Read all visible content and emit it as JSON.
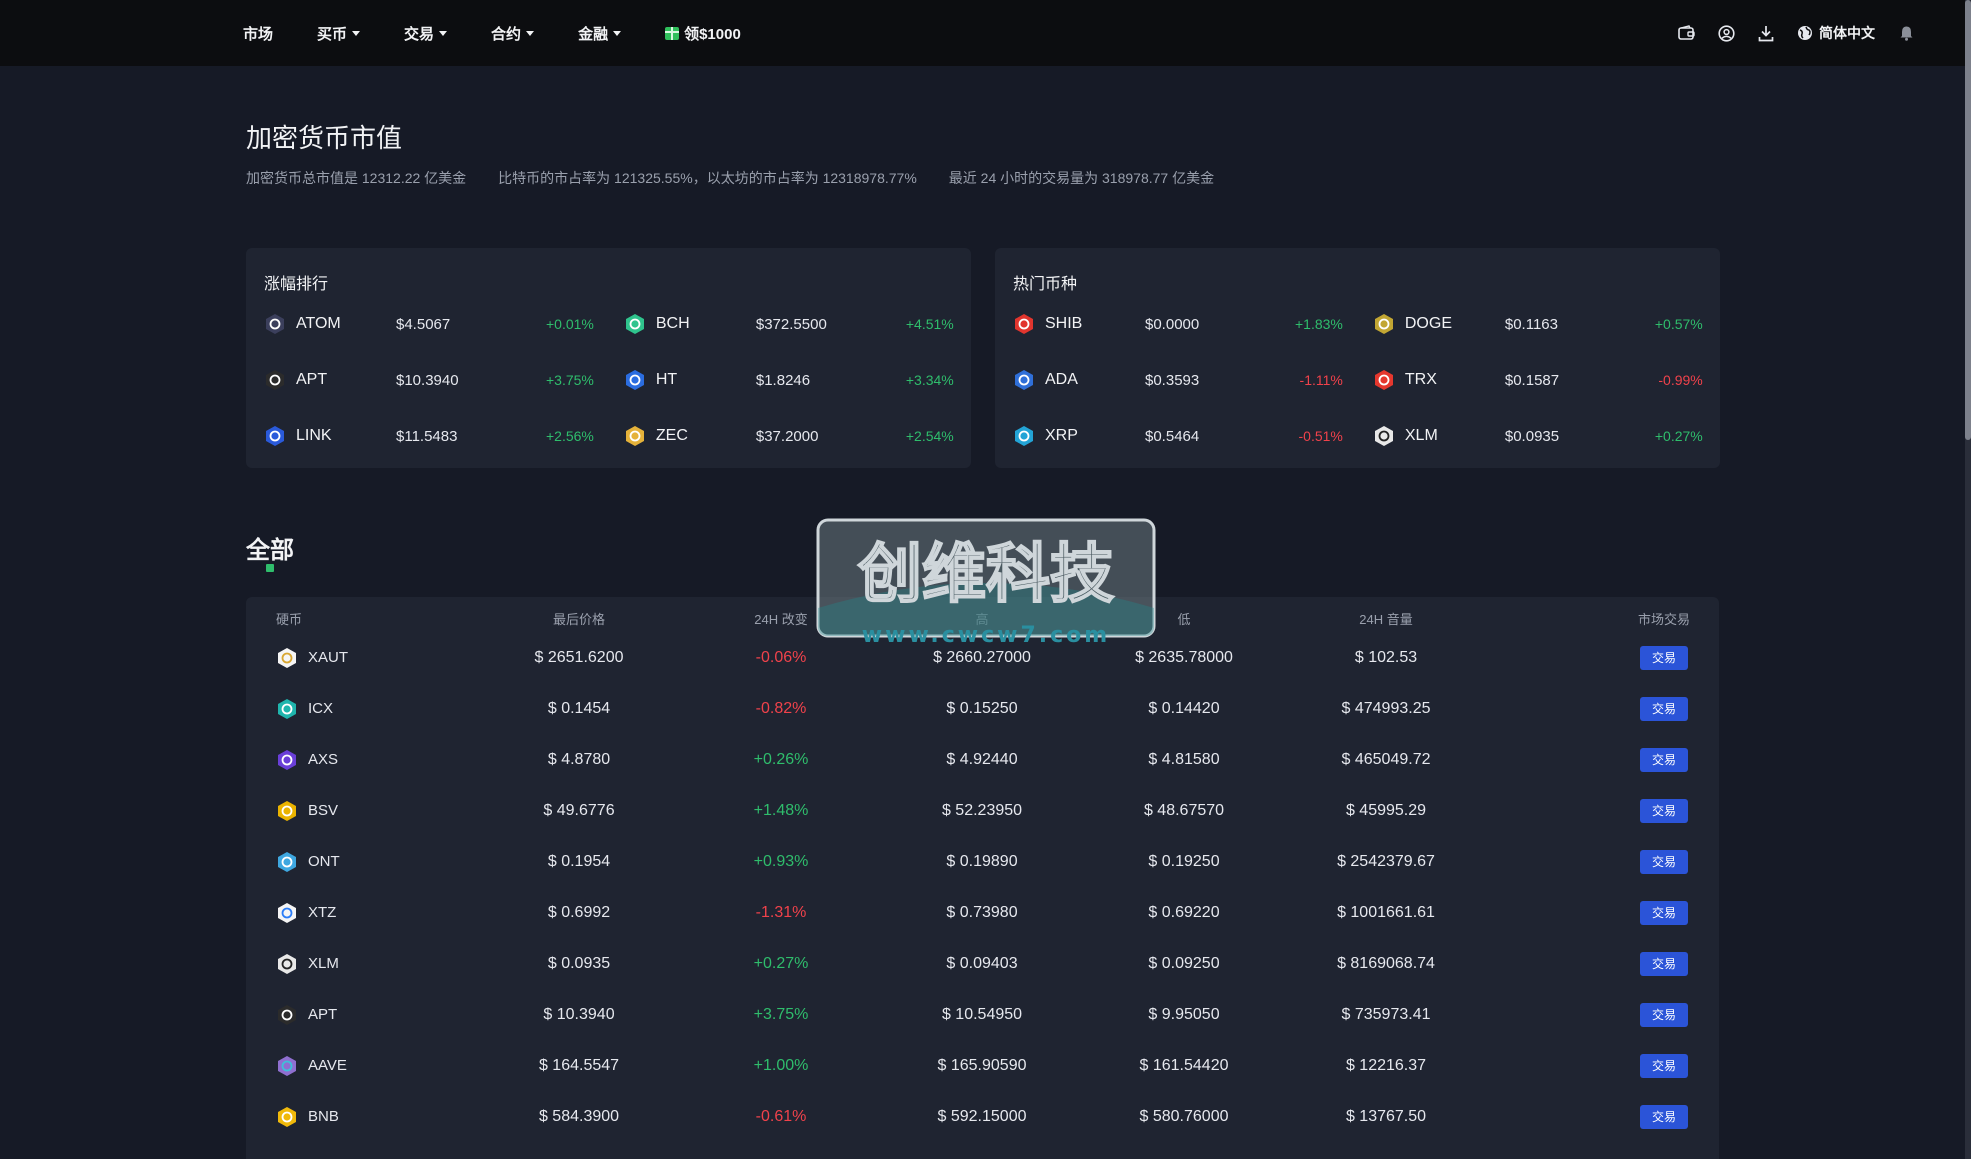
{
  "nav": {
    "items": [
      {
        "label": "市场",
        "has_caret": false
      },
      {
        "label": "买币",
        "has_caret": true
      },
      {
        "label": "交易",
        "has_caret": true
      },
      {
        "label": "合约",
        "has_caret": true
      },
      {
        "label": "金融",
        "has_caret": true
      }
    ],
    "promo_label": "领$1000",
    "language": "简体中文"
  },
  "header": {
    "title": "加密货币市值",
    "stats": [
      "加密货币总市值是 12312.22 亿美金",
      "比特币的市占率为 121325.55%，以太坊的市占率为 12318978.77%",
      "最近 24 小时的交易量为 318978.77 亿美金"
    ]
  },
  "gainers": {
    "title": "涨幅排行",
    "items": [
      {
        "symbol": "ATOM",
        "price": "$4.5067",
        "change": "+0.01%",
        "dir": "up",
        "color": "#3b3f5c"
      },
      {
        "symbol": "BCH",
        "price": "$372.5500",
        "change": "+4.51%",
        "dir": "up",
        "color": "#2fc48d"
      },
      {
        "symbol": "APT",
        "price": "$10.3940",
        "change": "+3.75%",
        "dir": "up",
        "color": "#2b2b2b"
      },
      {
        "symbol": "HT",
        "price": "$1.8246",
        "change": "+3.34%",
        "dir": "up",
        "color": "#2b6de0"
      },
      {
        "symbol": "LINK",
        "price": "$11.5483",
        "change": "+2.56%",
        "dir": "up",
        "color": "#2a5ada"
      },
      {
        "symbol": "ZEC",
        "price": "$37.2000",
        "change": "+2.54%",
        "dir": "up",
        "color": "#e5b23a"
      }
    ]
  },
  "hot": {
    "title": "热门币种",
    "items": [
      {
        "symbol": "SHIB",
        "price": "$0.0000",
        "change": "+1.83%",
        "dir": "up",
        "color": "#e1352e"
      },
      {
        "symbol": "DOGE",
        "price": "$0.1163",
        "change": "+0.57%",
        "dir": "up",
        "color": "#c2a633"
      },
      {
        "symbol": "ADA",
        "price": "$0.3593",
        "change": "-1.11%",
        "dir": "down",
        "color": "#2f6fd8"
      },
      {
        "symbol": "TRX",
        "price": "$0.1587",
        "change": "-0.99%",
        "dir": "down",
        "color": "#e5372e"
      },
      {
        "symbol": "XRP",
        "price": "$0.5464",
        "change": "-0.51%",
        "dir": "down",
        "color": "#23a4d6"
      },
      {
        "symbol": "XLM",
        "price": "$0.0935",
        "change": "+0.27%",
        "dir": "up",
        "color": "#e8e8e8"
      }
    ]
  },
  "all": {
    "title": "全部",
    "headers": {
      "coin": "硬币",
      "last": "最后价格",
      "change": "24H 改变",
      "high": "高",
      "low": "低",
      "volume": "24H 音量",
      "trade": "市场交易"
    },
    "trade_label": "交易",
    "rows": [
      {
        "symbol": "XAUT",
        "last": "$ 2651.6200",
        "change": "-0.06%",
        "dir": "down",
        "high": "$ 2660.27000",
        "low": "$ 2635.78000",
        "volume": "$ 102.53",
        "color": "#f5f5f5",
        "dot": "#d8a631"
      },
      {
        "symbol": "ICX",
        "last": "$ 0.1454",
        "change": "-0.82%",
        "dir": "down",
        "high": "$ 0.15250",
        "low": "$ 0.14420",
        "volume": "$ 474993.25",
        "color": "#1fb5ad",
        "dot": "#ffffff"
      },
      {
        "symbol": "AXS",
        "last": "$ 4.8780",
        "change": "+0.26%",
        "dir": "up",
        "high": "$ 4.92440",
        "low": "$ 4.81580",
        "volume": "$ 465049.72",
        "color": "#6a3fd8",
        "dot": "#ffffff"
      },
      {
        "symbol": "BSV",
        "last": "$ 49.6776",
        "change": "+1.48%",
        "dir": "up",
        "high": "$ 52.23950",
        "low": "$ 48.67570",
        "volume": "$ 45995.29",
        "color": "#eab300",
        "dot": "#ffffff"
      },
      {
        "symbol": "ONT",
        "last": "$ 0.1954",
        "change": "+0.93%",
        "dir": "up",
        "high": "$ 0.19890",
        "low": "$ 0.19250",
        "volume": "$ 2542379.67",
        "color": "#3ea7e0",
        "dot": "#ffffff"
      },
      {
        "symbol": "XTZ",
        "last": "$ 0.6992",
        "change": "-1.31%",
        "dir": "down",
        "high": "$ 0.73980",
        "low": "$ 0.69220",
        "volume": "$ 1001661.61",
        "color": "#f5f5f5",
        "dot": "#2c7df7"
      },
      {
        "symbol": "XLM",
        "last": "$ 0.0935",
        "change": "+0.27%",
        "dir": "up",
        "high": "$ 0.09403",
        "low": "$ 0.09250",
        "volume": "$ 8169068.74",
        "color": "#e8e8e8",
        "dot": "#222222"
      },
      {
        "symbol": "APT",
        "last": "$ 10.3940",
        "change": "+3.75%",
        "dir": "up",
        "high": "$ 10.54950",
        "low": "$ 9.95050",
        "volume": "$ 735973.41",
        "color": "#2b2b2b",
        "dot": "#ffffff"
      },
      {
        "symbol": "AAVE",
        "last": "$ 164.5547",
        "change": "+1.00%",
        "dir": "up",
        "high": "$ 165.90590",
        "low": "$ 161.54420",
        "volume": "$ 12216.37",
        "color": "#8f6fd0",
        "dot": "#3fc0d8"
      },
      {
        "symbol": "BNB",
        "last": "$ 584.3900",
        "change": "-0.61%",
        "dir": "down",
        "high": "$ 592.15000",
        "low": "$ 580.76000",
        "volume": "$ 13767.50",
        "color": "#f0b90b",
        "dot": "#ffffff"
      }
    ]
  },
  "watermark": {
    "title": "创维科技",
    "url": "www.cwcw7.com"
  }
}
